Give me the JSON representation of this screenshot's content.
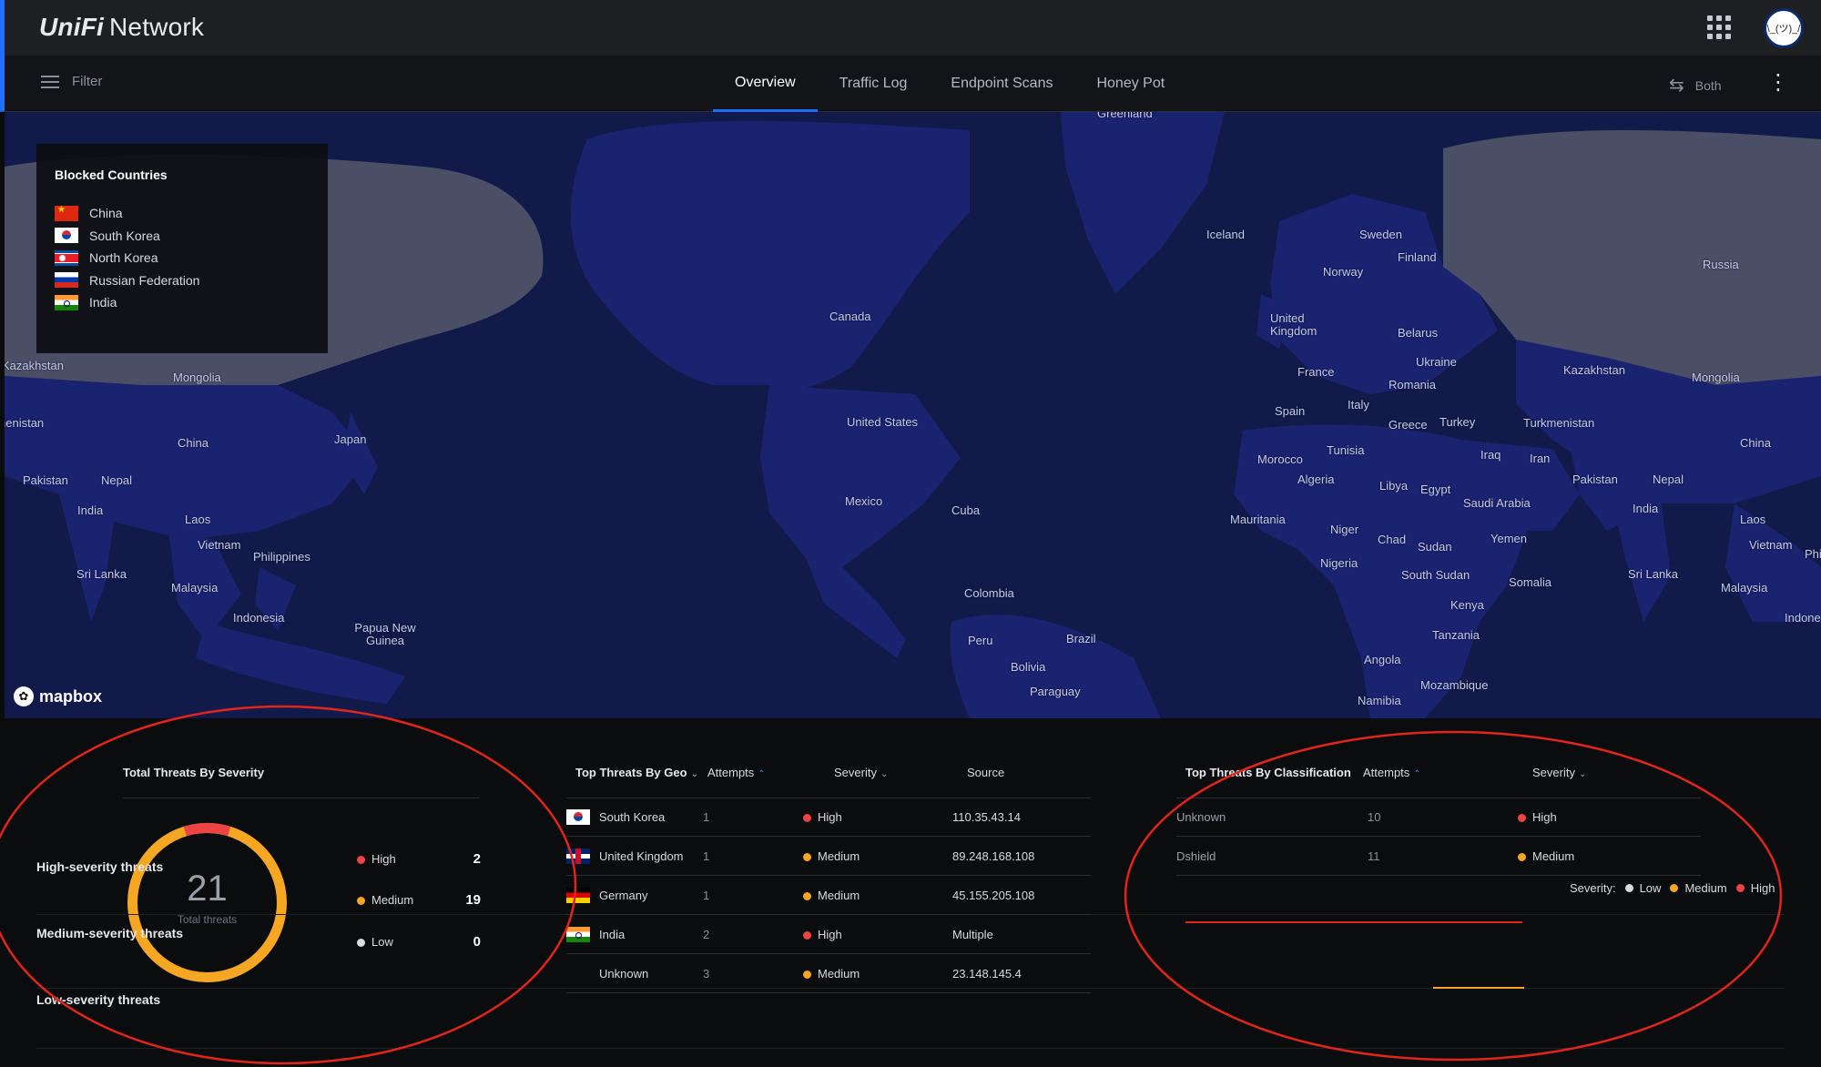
{
  "app": {
    "brand": "UniFi",
    "product": "Network",
    "avatar_text": "\\_(ツ)_/"
  },
  "nav": {
    "filter_label": "Filter",
    "tabs": [
      {
        "label": "Overview",
        "active": true
      },
      {
        "label": "Traffic Log",
        "active": false
      },
      {
        "label": "Endpoint Scans",
        "active": false
      },
      {
        "label": "Honey Pot",
        "active": false
      }
    ],
    "direction_label": "Both"
  },
  "map": {
    "attribution": "mapbox",
    "labels": [
      "Greenland",
      "Iceland",
      "Sweden",
      "Finland",
      "Norway",
      "Russia",
      "United Kingdom",
      "Belarus",
      "Ukraine",
      "France",
      "Romania",
      "Italy",
      "Spain",
      "Greece",
      "Turkey",
      "Kazakhstan",
      "Mongolia",
      "Turkmenistan",
      "China",
      "Tunisia",
      "Morocco",
      "Iraq",
      "Iran",
      "Algeria",
      "Libya",
      "Egypt",
      "Saudi Arabia",
      "Pakistan",
      "Nepal",
      "India",
      "Laos",
      "Vietnam",
      "Mauritania",
      "Niger",
      "Chad",
      "Sudan",
      "Yemen",
      "Nigeria",
      "South Sudan",
      "Somalia",
      "Sri Lanka",
      "Malaysia",
      "Kenya",
      "Tanzania",
      "Angola",
      "Mozambique",
      "Namibia",
      "Canada",
      "United States",
      "Mexico",
      "Cuba",
      "Colombia",
      "Peru",
      "Brazil",
      "Bolivia",
      "Paraguay",
      "Japan",
      "Philippines",
      "Indonesia",
      "Papua New Guinea",
      "nenistan",
      "Phi",
      "Indone"
    ]
  },
  "blocked_countries": {
    "title": "Blocked Countries",
    "items": [
      {
        "name": "China",
        "flag": "cn"
      },
      {
        "name": "South Korea",
        "flag": "kr"
      },
      {
        "name": "North Korea",
        "flag": "kp"
      },
      {
        "name": "Russian Federation",
        "flag": "ru"
      },
      {
        "name": "India",
        "flag": "in"
      }
    ]
  },
  "severity_panel": {
    "title": "Total Threats By Severity",
    "total": 21,
    "total_label": "Total threats",
    "row_labels": [
      "High-severity threats",
      "Medium-severity threats",
      "Low-severity threats"
    ],
    "legend": [
      {
        "label": "High",
        "value": 2
      },
      {
        "label": "Medium",
        "value": 19
      },
      {
        "label": "Low",
        "value": 0
      }
    ]
  },
  "geo_panel": {
    "title": "Top Threats By Geo",
    "columns": {
      "attempts": "Attempts",
      "severity": "Severity",
      "source": "Source"
    },
    "rows": [
      {
        "country": "South Korea",
        "flag": "kr",
        "attempts": "1",
        "severity": "High",
        "source": "110.35.43.14"
      },
      {
        "country": "United Kingdom",
        "flag": "gb",
        "attempts": "1",
        "severity": "Medium",
        "source": "89.248.168.108"
      },
      {
        "country": "Germany",
        "flag": "de",
        "attempts": "1",
        "severity": "Medium",
        "source": "45.155.205.108"
      },
      {
        "country": "India",
        "flag": "in",
        "attempts": "2",
        "severity": "High",
        "source": "Multiple"
      },
      {
        "country": "Unknown",
        "flag": "",
        "attempts": "3",
        "severity": "Medium",
        "source": "23.148.145.4"
      }
    ]
  },
  "classification_panel": {
    "title": "Top Threats By Classification",
    "columns": {
      "attempts": "Attempts",
      "severity": "Severity"
    },
    "rows": [
      {
        "type": "Unknown",
        "attempts": "10",
        "severity": "High"
      },
      {
        "type": "Dshield",
        "attempts": "11",
        "severity": "Medium"
      }
    ],
    "legend_title": "Severity:",
    "legend": [
      "Low",
      "Medium",
      "High"
    ]
  },
  "colors": {
    "high": "#ef4444",
    "medium": "#f5a623",
    "low": "#d7dbe0",
    "accent": "#1f6fff",
    "annotation": "#e0261b"
  }
}
